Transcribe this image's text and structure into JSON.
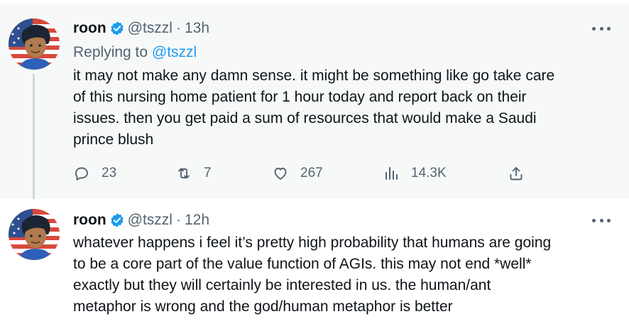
{
  "tweets": [
    {
      "author": {
        "name": "roon",
        "handle": "@tszzl"
      },
      "time": "13h",
      "separator": "·",
      "reply_label": "Replying to",
      "reply_handle": "@tszzl",
      "text_lines": [
        "it may not make any damn sense. it might be something like go take care",
        "of this nursing home patient for 1 hour today and report back on their",
        "issues. then you get paid a sum of resources that would make a Saudi",
        "prince blush"
      ],
      "stats": {
        "replies": "23",
        "retweets": "7",
        "likes": "267",
        "views": "14.3K"
      }
    },
    {
      "author": {
        "name": "roon",
        "handle": "@tszzl"
      },
      "time": "12h",
      "separator": "·",
      "text_lines": [
        "whatever happens i feel it’s pretty high probability that humans are going",
        "to be a core part of the value function of AGIs. this may not end *well*",
        "exactly but they will certainly be interested in us. the human/ant",
        "metaphor is wrong and the god/human metaphor is better"
      ]
    }
  ],
  "colors": {
    "verified": "#1d9bf0",
    "link": "#1d9bf0",
    "muted": "#536471",
    "thread_line": "#cfd9de"
  },
  "icons": [
    "verified-badge-icon",
    "more-icon",
    "reply-icon",
    "retweet-icon",
    "like-icon",
    "views-icon",
    "share-icon"
  ]
}
